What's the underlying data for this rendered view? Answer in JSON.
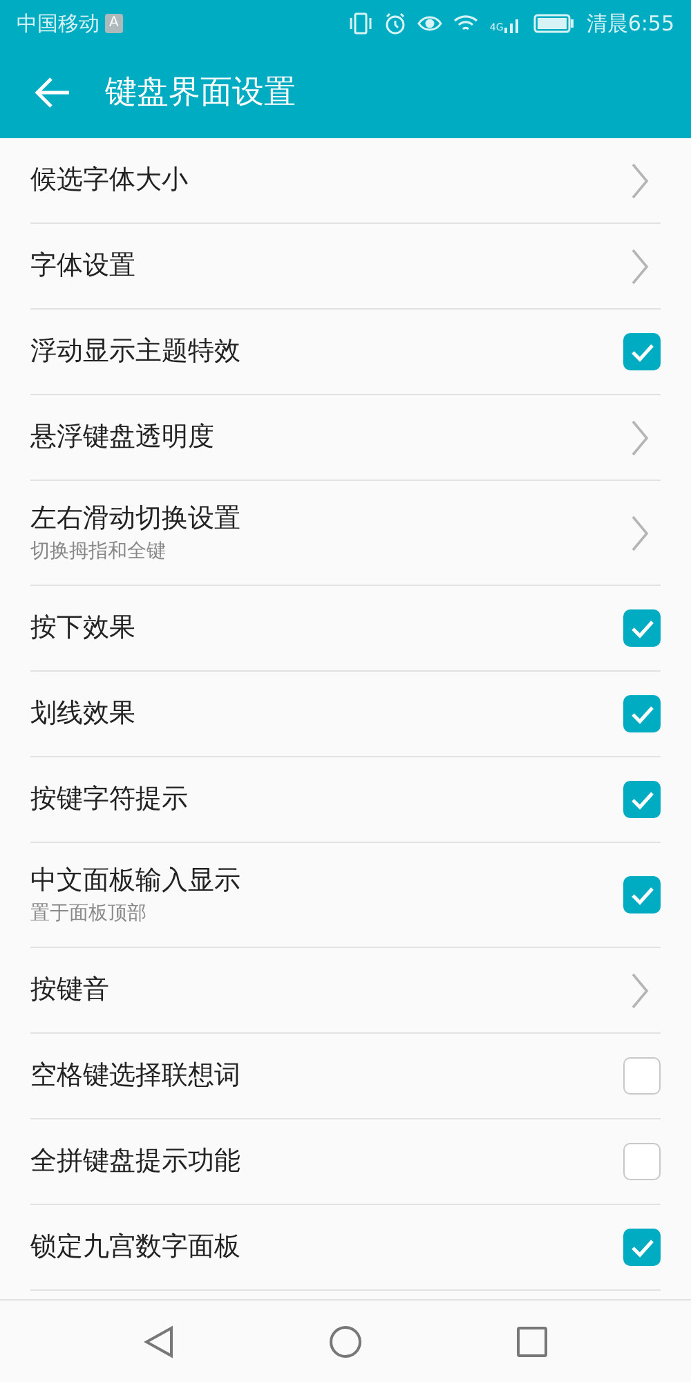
{
  "status_bar": {
    "carrier": "中国移动",
    "badge": "A",
    "network": "4G",
    "time": "清晨6:55"
  },
  "app_bar": {
    "title": "键盘界面设置"
  },
  "settings": [
    {
      "kind": "link",
      "title": "候选字体大小"
    },
    {
      "kind": "link",
      "title": "字体设置"
    },
    {
      "kind": "checkbox",
      "title": "浮动显示主题特效",
      "checked": true
    },
    {
      "kind": "link",
      "title": "悬浮键盘透明度"
    },
    {
      "kind": "link",
      "title": "左右滑动切换设置",
      "subtitle": "切换拇指和全键"
    },
    {
      "kind": "checkbox",
      "title": "按下效果",
      "checked": true
    },
    {
      "kind": "checkbox",
      "title": "划线效果",
      "checked": true
    },
    {
      "kind": "checkbox",
      "title": "按键字符提示",
      "checked": true
    },
    {
      "kind": "checkbox",
      "title": "中文面板输入显示",
      "subtitle": "置于面板顶部",
      "checked": true
    },
    {
      "kind": "link",
      "title": "按键音"
    },
    {
      "kind": "checkbox",
      "title": "空格键选择联想词",
      "checked": false
    },
    {
      "kind": "checkbox",
      "title": "全拼键盘提示功能",
      "checked": false
    },
    {
      "kind": "checkbox",
      "title": "锁定九宫数字面板",
      "checked": true
    }
  ]
}
